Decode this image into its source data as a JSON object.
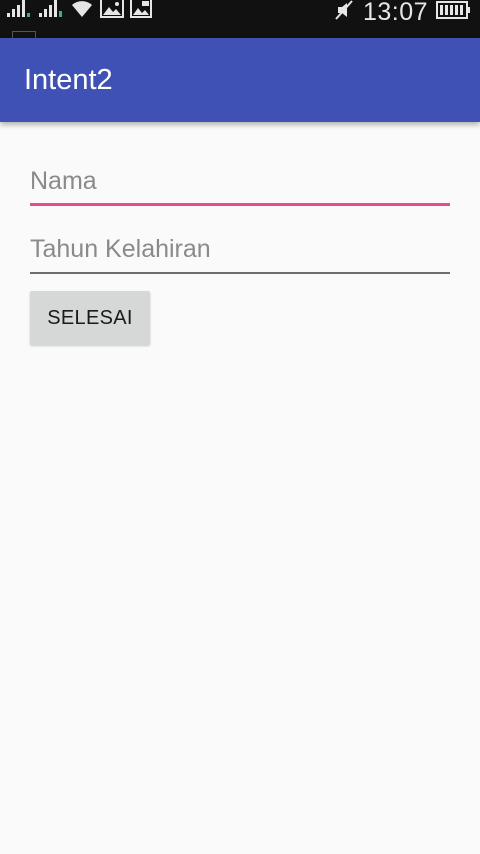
{
  "status_bar": {
    "time": "13:07",
    "icons": [
      "signal-icon",
      "signal-icon",
      "wifi-icon",
      "image-icon",
      "gallery-icon",
      "mute-icon",
      "battery-icon"
    ]
  },
  "app_bar": {
    "title": "Intent2",
    "color": "#3f51b5"
  },
  "form": {
    "nama": {
      "placeholder": "Nama",
      "value": ""
    },
    "tahun_kelahiran": {
      "placeholder": "Tahun Kelahiran",
      "value": ""
    },
    "submit_label": "SELESAI"
  },
  "colors": {
    "accent": "#e84c8a",
    "status_bar": "#111111",
    "background": "#fafafa",
    "button": "#d6d7d7"
  }
}
